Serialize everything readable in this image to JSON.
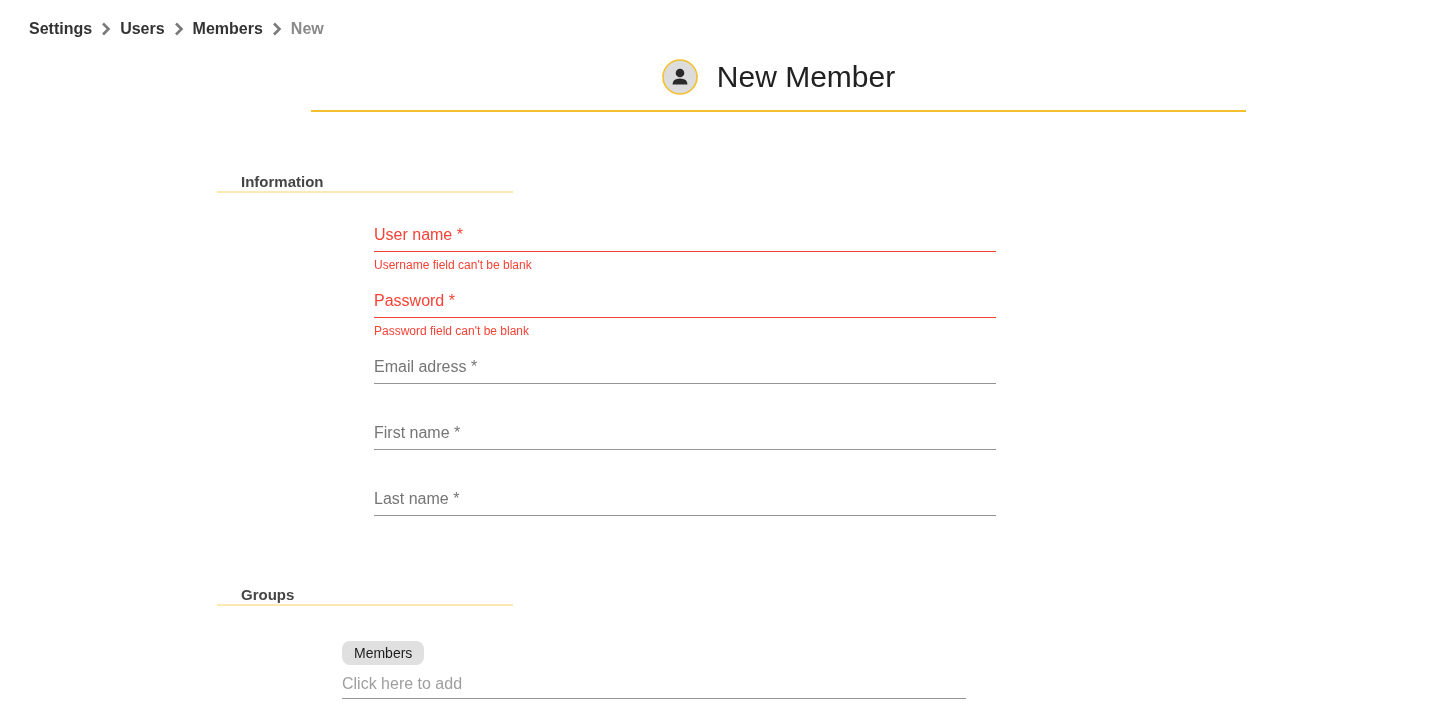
{
  "breadcrumb": [
    {
      "label": "Settings",
      "current": false
    },
    {
      "label": "Users",
      "current": false
    },
    {
      "label": "Members",
      "current": false
    },
    {
      "label": "New",
      "current": true
    }
  ],
  "header": {
    "title": "New Member"
  },
  "sections": [
    {
      "kind": "form",
      "title": "Information",
      "fields": [
        {
          "label": "User name *",
          "error": "Username field can't be blank"
        },
        {
          "label": "Password *",
          "error": "Password field can't be blank"
        },
        {
          "label": "Email adress *"
        },
        {
          "label": "First name *"
        },
        {
          "label": "Last name *"
        }
      ]
    },
    {
      "kind": "groups",
      "title": "Groups",
      "chips": [
        {
          "label": "Members"
        }
      ],
      "input": {
        "placeholder": "Click here to add"
      }
    }
  ]
}
